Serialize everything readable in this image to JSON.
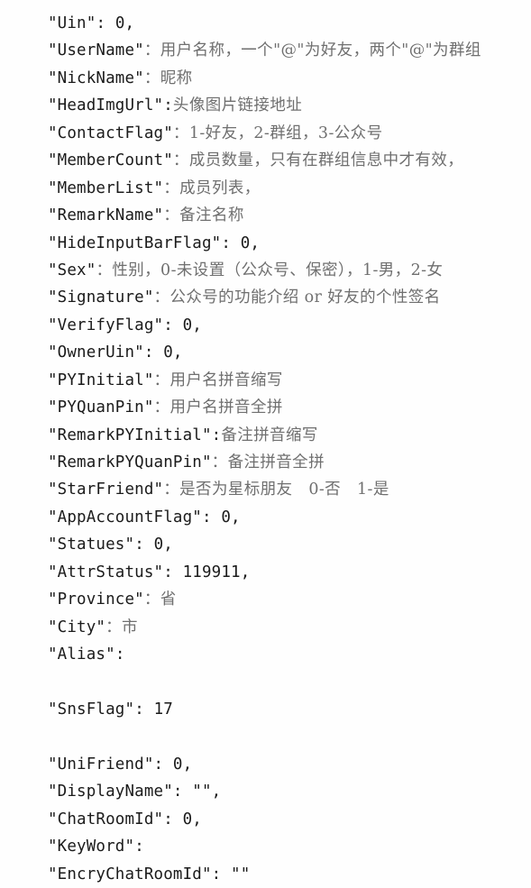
{
  "document": {
    "kind": "code-snippet",
    "language": "json",
    "background_color": "#fefefe",
    "key_text_color": "#1b1b1b",
    "comment_text_color": "#6f6f6f",
    "lines": [
      {
        "key": "\"Uin\"",
        "sep": ": ",
        "value": "0,",
        "value_kind": "ascii"
      },
      {
        "key": "\"UserName\"",
        "sep": "：",
        "value": "用户名称，一个\"@\"为好友，两个\"@\"为群组",
        "value_kind": "cjk"
      },
      {
        "key": "\"NickName\"",
        "sep": "：",
        "value": "昵称",
        "value_kind": "cjk"
      },
      {
        "key": "\"HeadImgUrl\"",
        "sep": ":",
        "value": "头像图片链接地址",
        "value_kind": "cjk"
      },
      {
        "key": "\"ContactFlag\"",
        "sep": "：",
        "value": "1-好友，2-群组，3-公众号",
        "value_kind": "cjk"
      },
      {
        "key": "\"MemberCount\"",
        "sep": "：",
        "value": "成员数量，只有在群组信息中才有效，",
        "value_kind": "cjk"
      },
      {
        "key": "\"MemberList\"",
        "sep": "：",
        "value": "成员列表，",
        "value_kind": "cjk"
      },
      {
        "key": "\"RemarkName\"",
        "sep": "：",
        "value": "备注名称",
        "value_kind": "cjk"
      },
      {
        "key": "\"HideInputBarFlag\"",
        "sep": ": ",
        "value": "0,",
        "value_kind": "ascii"
      },
      {
        "key": "\"Sex\"",
        "sep": "：",
        "value": "性别，0-未设置（公众号、保密），1-男，2-女",
        "value_kind": "cjk"
      },
      {
        "key": "\"Signature\"",
        "sep": "：",
        "value": "公众号的功能介绍 or 好友的个性签名",
        "value_kind": "cjk"
      },
      {
        "key": "\"VerifyFlag\"",
        "sep": ": ",
        "value": "0,",
        "value_kind": "ascii"
      },
      {
        "key": "\"OwnerUin\"",
        "sep": ": ",
        "value": "0,",
        "value_kind": "ascii"
      },
      {
        "key": "\"PYInitial\"",
        "sep": "：",
        "value": "用户名拼音缩写",
        "value_kind": "cjk"
      },
      {
        "key": "\"PYQuanPin\"",
        "sep": "：",
        "value": "用户名拼音全拼",
        "value_kind": "cjk"
      },
      {
        "key": "\"RemarkPYInitial\"",
        "sep": ":",
        "value": "备注拼音缩写",
        "value_kind": "cjk"
      },
      {
        "key": "\"RemarkPYQuanPin\"",
        "sep": "：",
        "value": "备注拼音全拼",
        "value_kind": "cjk"
      },
      {
        "key": "\"StarFriend\"",
        "sep": "：",
        "value": "是否为星标朋友　0-否　1-是",
        "value_kind": "cjk"
      },
      {
        "key": "\"AppAccountFlag\"",
        "sep": ": ",
        "value": "0,",
        "value_kind": "ascii"
      },
      {
        "key": "\"Statues\"",
        "sep": ": ",
        "value": "0,",
        "value_kind": "ascii"
      },
      {
        "key": "\"AttrStatus\"",
        "sep": ": ",
        "value": "119911,",
        "value_kind": "ascii"
      },
      {
        "key": "\"Province\"",
        "sep": "：",
        "value": "省",
        "value_kind": "cjk"
      },
      {
        "key": "\"City\"",
        "sep": "：",
        "value": "市",
        "value_kind": "cjk"
      },
      {
        "key": "\"Alias\"",
        "sep": ":",
        "value": "",
        "value_kind": "ascii"
      },
      {
        "key": "",
        "sep": "",
        "value": "",
        "value_kind": "blank"
      },
      {
        "key": "\"SnsFlag\"",
        "sep": ": ",
        "value": "17",
        "value_kind": "ascii"
      },
      {
        "key": "",
        "sep": "",
        "value": "",
        "value_kind": "blank"
      },
      {
        "key": "\"UniFriend\"",
        "sep": ": ",
        "value": "0,",
        "value_kind": "ascii"
      },
      {
        "key": "\"DisplayName\"",
        "sep": ": ",
        "value": "\"\",",
        "value_kind": "ascii"
      },
      {
        "key": "\"ChatRoomId\"",
        "sep": ": ",
        "value": "0,",
        "value_kind": "ascii"
      },
      {
        "key": "\"KeyWord\"",
        "sep": ":",
        "value": "",
        "value_kind": "ascii"
      },
      {
        "key": "\"EncryChatRoomId\"",
        "sep": ": ",
        "value": "\"\"",
        "value_kind": "ascii"
      }
    ]
  }
}
